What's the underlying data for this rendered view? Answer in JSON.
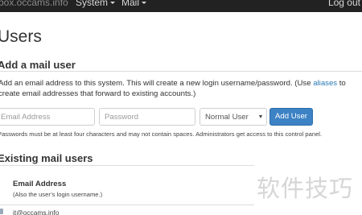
{
  "navbar": {
    "brand": "box.occams.info",
    "system_label": "System",
    "mail_label": "Mail",
    "logout_label": "Log out"
  },
  "page": {
    "title": "Users"
  },
  "add_user": {
    "heading": "Add a mail user",
    "intro_before_link": "Add an email address to this system. This will create a new login username/password. (Use ",
    "intro_link": "aliases",
    "intro_after_link": " to create email addresses that forward to existing accounts.)",
    "email_placeholder": "Email Address",
    "password_placeholder": "Password",
    "privilege_selected": "Normal User",
    "submit_label": "Add User",
    "help_text": "Passwords must be at least four characters and may not contain spaces. Administrators get access to this control panel."
  },
  "existing": {
    "heading": "Existing mail users",
    "column_title": "Email Address",
    "column_subtitle": "(Also the user’s login username.)",
    "rows": [
      {
        "email": "jt@occams.info"
      }
    ]
  },
  "watermark": {
    "text": "软件技巧"
  },
  "colors": {
    "navbar_bg": "#222222",
    "primary_button": "#3c82c4",
    "link": "#2a7ab5"
  }
}
